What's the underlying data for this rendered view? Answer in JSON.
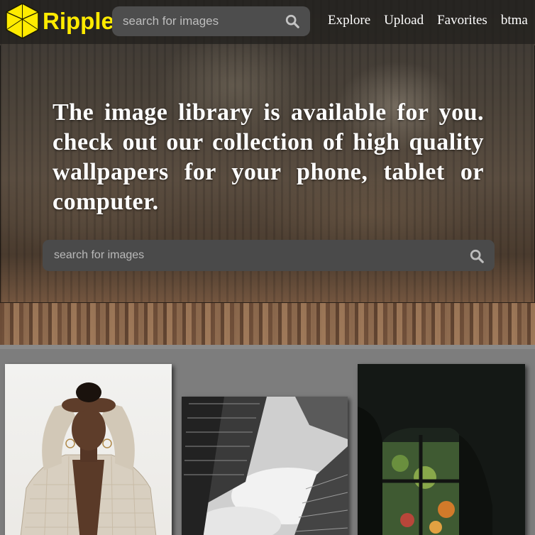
{
  "header": {
    "brand": "Ripple",
    "search_placeholder": "search for images",
    "nav": [
      "Explore",
      "Upload",
      "Favorites",
      "btma"
    ]
  },
  "hero": {
    "tagline": "The image library is available for you. check out our collection of high quality wallpapers for your phone, tablet or computer.",
    "search_placeholder": "search for images"
  },
  "colors": {
    "brand": "#ffeb00",
    "navbar": "#201e1c",
    "search_bg": "#4a4a4a",
    "gallery_bg": "#7d7d7d"
  },
  "icons": {
    "logo": "hexagon-logo-icon",
    "search": "search-icon"
  }
}
